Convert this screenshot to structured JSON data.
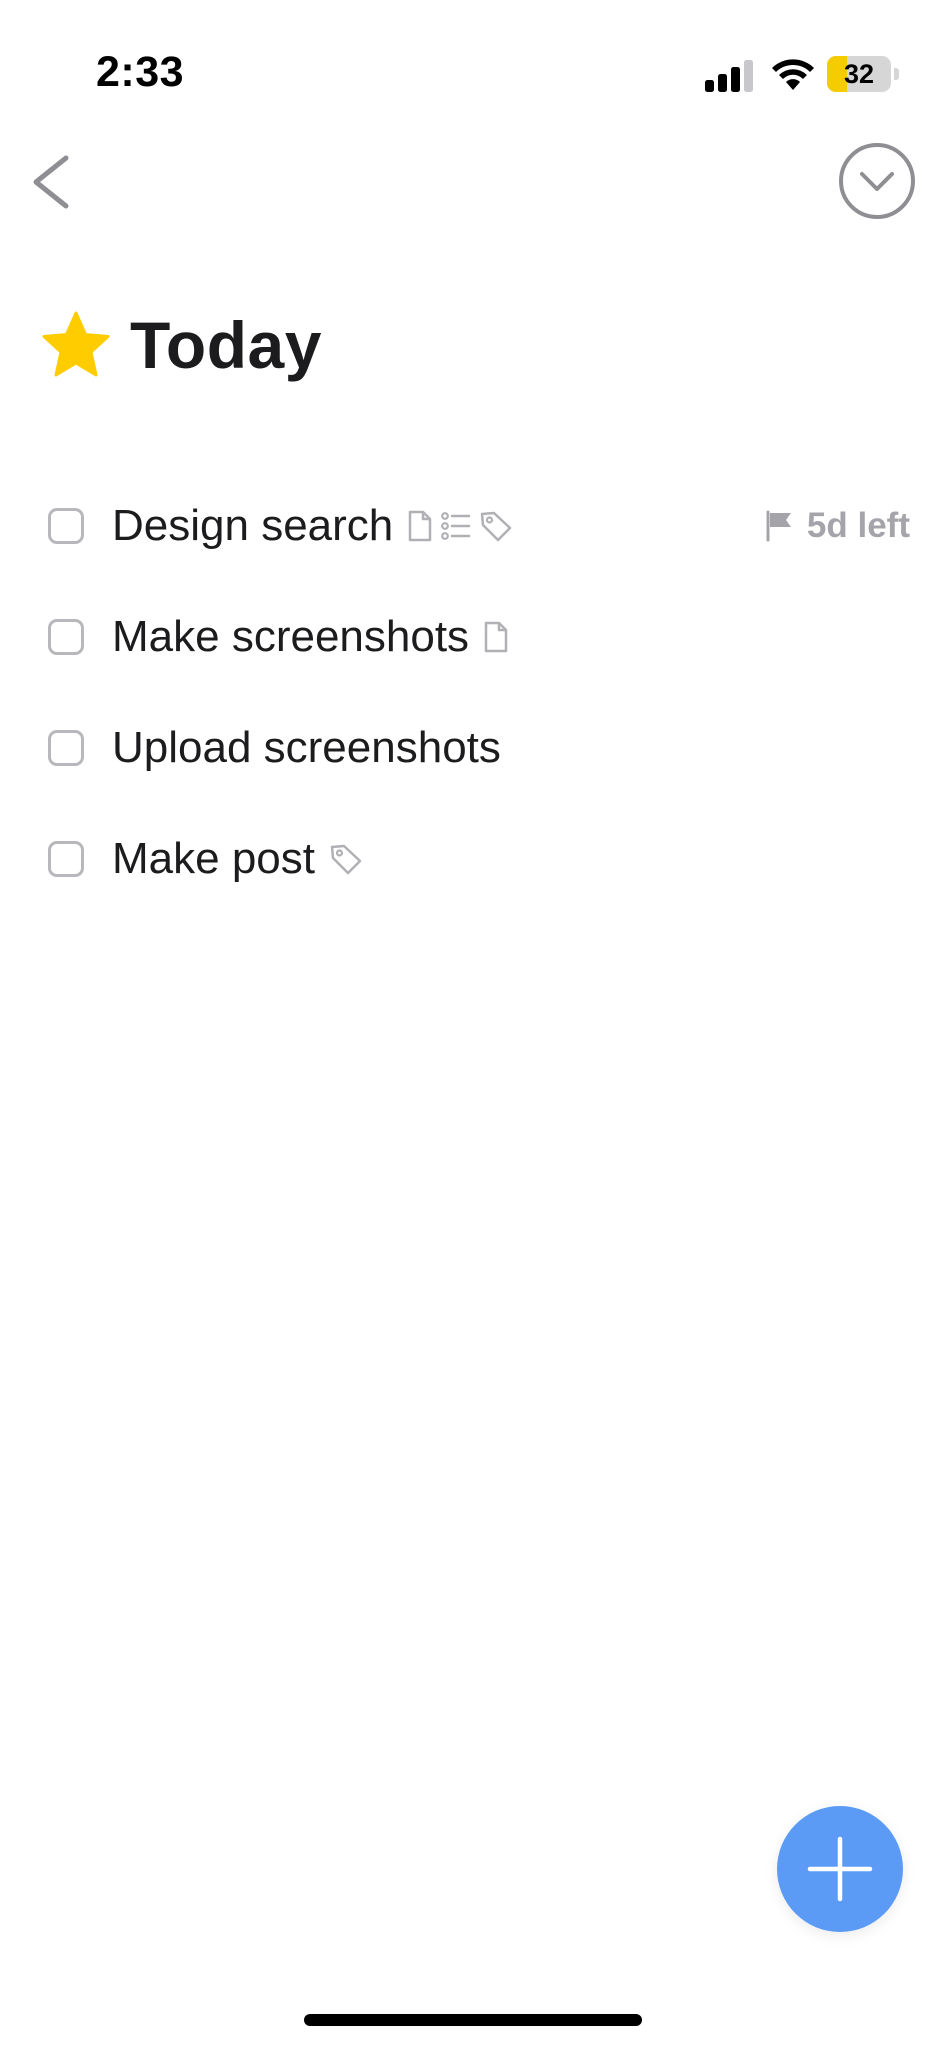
{
  "status_bar": {
    "time": "2:33",
    "battery_level": "32",
    "battery_fraction": 0.32,
    "signal_icon": "cellular-signal-icon",
    "wifi_icon": "wifi-icon",
    "battery_color": "#f5cc00"
  },
  "nav": {
    "back_icon": "chevron-left-icon",
    "more_icon": "circle-chevron-down-icon"
  },
  "header": {
    "icon": "star-icon",
    "icon_color": "#ffcc00",
    "title": "Today"
  },
  "tasks": [
    {
      "title": "Design search",
      "icons": [
        "note-icon",
        "checklist-icon",
        "tag-icon"
      ],
      "due_icon": "flag-icon",
      "due": "5d left"
    },
    {
      "title": "Make screenshots",
      "icons": [
        "note-icon"
      ]
    },
    {
      "title": "Upload screenshots",
      "icons": []
    },
    {
      "title": "Make post",
      "icons": [
        "tag-icon"
      ]
    }
  ],
  "fab": {
    "icon": "plus-icon",
    "color": "#5b9bf5"
  }
}
